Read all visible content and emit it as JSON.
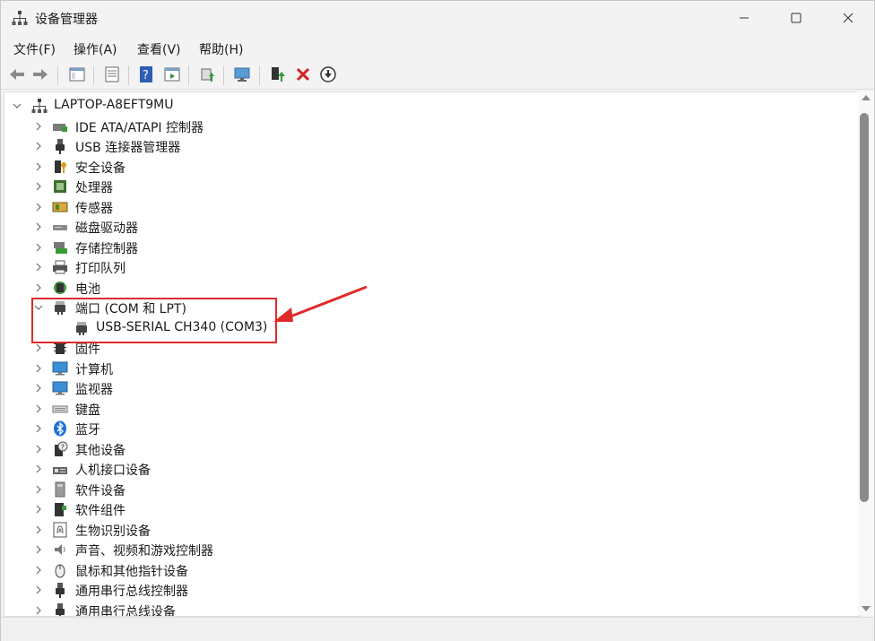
{
  "window": {
    "title": "设备管理器"
  },
  "menu": [
    "文件(F)",
    "操作(A)",
    "查看(V)",
    "帮助(H)"
  ],
  "tree": {
    "root": "LAPTOP-A8EFT9MU",
    "items": [
      {
        "label": "IDE ATA/ATAPI 控制器",
        "icon": "ide-controller-icon"
      },
      {
        "label": "USB 连接器管理器",
        "icon": "usb-connector-icon"
      },
      {
        "label": "安全设备",
        "icon": "security-device-icon"
      },
      {
        "label": "处理器",
        "icon": "processor-icon"
      },
      {
        "label": "传感器",
        "icon": "sensor-icon"
      },
      {
        "label": "磁盘驱动器",
        "icon": "disk-drive-icon"
      },
      {
        "label": "存储控制器",
        "icon": "storage-controller-icon"
      },
      {
        "label": "打印队列",
        "icon": "printer-icon"
      },
      {
        "label": "电池",
        "icon": "battery-icon"
      },
      {
        "label": "端口 (COM 和 LPT)",
        "icon": "port-icon",
        "expanded": true
      },
      {
        "label": "USB-SERIAL CH340 (COM3)",
        "icon": "port-icon",
        "child": true
      },
      {
        "label": "固件",
        "icon": "firmware-icon"
      },
      {
        "label": "计算机",
        "icon": "computer-icon"
      },
      {
        "label": "监视器",
        "icon": "monitor-icon"
      },
      {
        "label": "键盘",
        "icon": "keyboard-icon"
      },
      {
        "label": "蓝牙",
        "icon": "bluetooth-icon"
      },
      {
        "label": "其他设备",
        "icon": "other-device-icon"
      },
      {
        "label": "人机接口设备",
        "icon": "hid-icon"
      },
      {
        "label": "软件设备",
        "icon": "software-device-icon"
      },
      {
        "label": "软件组件",
        "icon": "software-component-icon"
      },
      {
        "label": "生物识别设备",
        "icon": "biometric-icon"
      },
      {
        "label": "声音、视频和游戏控制器",
        "icon": "sound-icon"
      },
      {
        "label": "鼠标和其他指针设备",
        "icon": "mouse-icon"
      },
      {
        "label": "通用串行总线控制器",
        "icon": "usb-controller-icon"
      },
      {
        "label": "通用串行总线设备",
        "icon": "usb-device-icon"
      }
    ]
  },
  "colors": {
    "accent": "#e02a2a",
    "chevron": "#6b6b6b"
  }
}
